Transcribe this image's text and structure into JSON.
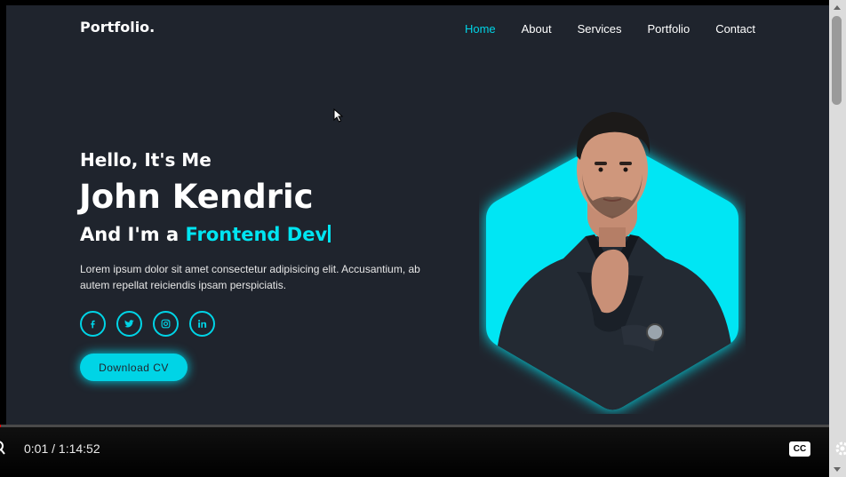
{
  "site": {
    "logo": "Portfolio.",
    "nav": [
      {
        "label": "Home",
        "active": true
      },
      {
        "label": "About",
        "active": false
      },
      {
        "label": "Services",
        "active": false
      },
      {
        "label": "Portfolio",
        "active": false
      },
      {
        "label": "Contact",
        "active": false
      }
    ]
  },
  "hero": {
    "greeting": "Hello, It's Me",
    "name": "John Kendric",
    "role_prefix": "And I'm a",
    "role_highlight": "Frontend Dev",
    "description": "Lorem ipsum dolor sit amet consectetur adipisicing elit. Accusantium, ab autem repellat reiciendis ipsam perspiciatis.",
    "socials": [
      "facebook-icon",
      "twitter-icon",
      "instagram-icon",
      "linkedin-icon"
    ],
    "cta_label": "Download CV"
  },
  "player": {
    "time_current": "0:01",
    "time_separator": "/",
    "time_total": "1:14:52",
    "progress": 0.0002,
    "cc_label": "CC"
  },
  "colors": {
    "accent": "#00d4e6",
    "background": "#1f242d"
  }
}
